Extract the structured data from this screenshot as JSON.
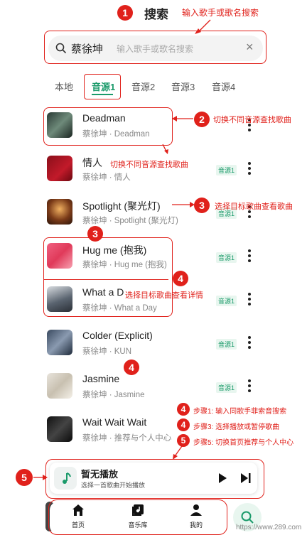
{
  "header": {
    "title": "搜索",
    "badge": "1",
    "annotation": "输入歌手或歌名搜索"
  },
  "search": {
    "value": "蔡徐坤",
    "placeholder": "输入歌手或歌名搜索",
    "clear": "×"
  },
  "tabs": [
    "本地",
    "音源1",
    "音源2",
    "音源3",
    "音源4"
  ],
  "songs": [
    {
      "title": "Deadman",
      "sub": "蔡徐坤 · Deadman",
      "tag": ""
    },
    {
      "title": "情人",
      "sub": "蔡徐坤 · 情人",
      "tag": "音源1"
    },
    {
      "title": "Spotlight (聚光灯)",
      "sub": "蔡徐坤 · Spotlight (聚光灯)",
      "tag": "音源1"
    },
    {
      "title": "Hug me (抱我)",
      "sub": "蔡徐坤 · Hug me (抱我)",
      "tag": "音源1"
    },
    {
      "title": "What a D",
      "sub": "蔡徐坤 · What a Day",
      "tag": "音源1"
    },
    {
      "title": "Colder (Explicit)",
      "sub": "蔡徐坤 · KUN",
      "tag": "音源1"
    },
    {
      "title": "Jasmine",
      "sub": "蔡徐坤 · Jasmine",
      "tag": "音源1"
    },
    {
      "title": "Wait Wait Wait",
      "sub": "蔡徐坤 · 推荐与个人中心",
      "tag": ""
    }
  ],
  "annotations": {
    "a2_num": "2",
    "a2_text": "切换不同音源查找歌曲",
    "a2b_text": "切换不同音源查找歌曲",
    "a3_num": "3",
    "a3_text": "选择目标歌曲查看歌曲",
    "a3b_num": "3",
    "a4_num": "4",
    "a4_text": "选择目标歌曲查看详情",
    "a4b_num": "4",
    "step1_num": "4",
    "step1_text": "步骤1: 输入同歌手菲索音搜索",
    "step3_num": "4",
    "step3_text": "步骤3: 选择播放或暂停歌曲",
    "step5_num": "5",
    "step5_text": "步骤5: 切换首页推荐与个人中心",
    "a5_num": "5"
  },
  "player": {
    "title": "暂无播放",
    "subtitle": "选择一首歌曲开始播放"
  },
  "nav": {
    "home": "首页",
    "library": "音乐库",
    "mine": "我的"
  },
  "watermark": "https://www.289.com"
}
